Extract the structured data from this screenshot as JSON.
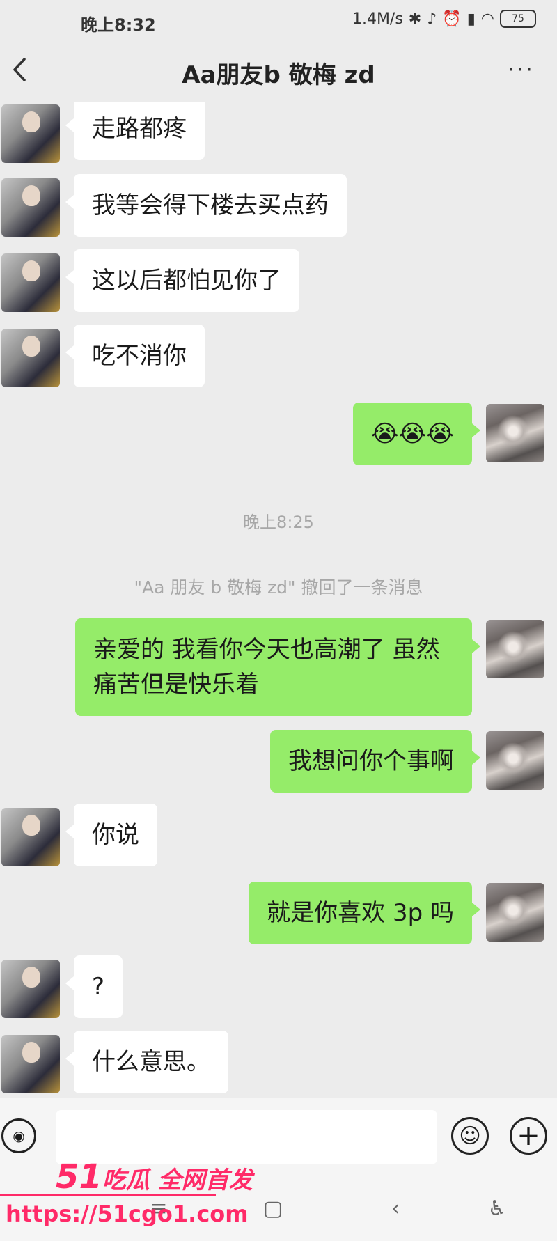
{
  "status_bar": {
    "time": "晚上8:32",
    "network_speed": "1.4M/s",
    "battery": "75",
    "icons": [
      "bluetooth-icon",
      "mute-icon",
      "alarm-icon",
      "signal-icon",
      "wifi-icon",
      "battery-icon"
    ]
  },
  "header": {
    "title": "Aa朋友b 敬梅 zd",
    "back_icon": "chevron-left-icon",
    "more_label": "···"
  },
  "messages": [
    {
      "side": "in",
      "text": "走路都疼"
    },
    {
      "side": "in",
      "text": "我等会得下楼去买点药"
    },
    {
      "side": "in",
      "text": "这以后都怕见你了"
    },
    {
      "side": "in",
      "text": "吃不消你"
    },
    {
      "side": "out",
      "text": "😭😭😭"
    },
    {
      "side": "out",
      "text": "亲爱的 我看你今天也高潮了 虽然痛苦但是快乐着"
    },
    {
      "side": "out",
      "text": "我想问你个事啊"
    },
    {
      "side": "in",
      "text": "你说"
    },
    {
      "side": "out",
      "text": "就是你喜欢 3p 吗"
    },
    {
      "side": "in",
      "text": "?"
    },
    {
      "side": "in",
      "text": "什么意思。"
    }
  ],
  "system": {
    "timestamp": "晚上8:25",
    "recall_notice": "\"Aa 朋友 b 敬梅 zd\" 撤回了一条消息"
  },
  "input_bar": {
    "voice_icon": "voice-icon",
    "emoji_icon": "emoji-icon",
    "plus_icon": "plus-icon"
  },
  "watermark": {
    "brand_num": "51",
    "brand_text": "吃瓜 全网首发",
    "url": "https://51cgo1.com"
  },
  "nav": {
    "icons": [
      "menu-icon",
      "home-icon",
      "back-icon",
      "accessibility-icon"
    ]
  },
  "colors": {
    "outgoing_bubble": "#95ec69",
    "incoming_bubble": "#ffffff",
    "background": "#ececec",
    "watermark": "#ff2a68"
  }
}
